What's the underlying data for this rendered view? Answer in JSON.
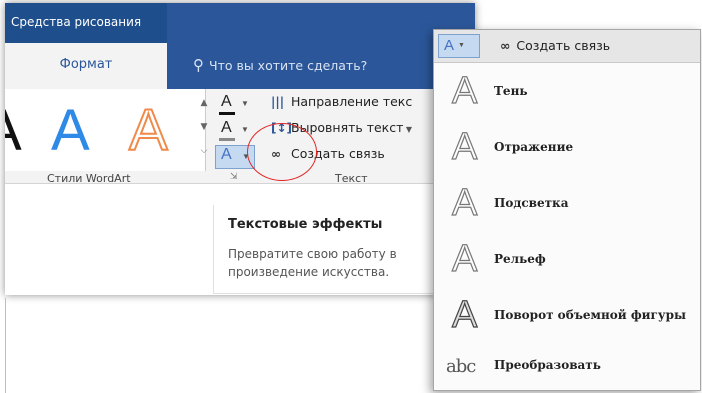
{
  "ribbon": {
    "context_tab": "Средства рисования",
    "format_tab": "Формат",
    "tell_me": "Что вы хотите сделать?",
    "group_wordart": "Стили WordArt",
    "group_text": "Текст",
    "btn_direction": "Направление текс",
    "btn_align": "Выровнять текст",
    "btn_link": "Создать связь"
  },
  "tooltip": {
    "title": "Текстовые эффекты",
    "desc": "Превратите свою работу в произведение искусства."
  },
  "dropdown": {
    "link": "Создать связь",
    "items": [
      "Тень",
      "Отражение",
      "Подсветка",
      "Рельеф",
      "Поворот объемной фигуры",
      "Преобразовать"
    ],
    "abc_icon": "abc"
  },
  "colors": {
    "accent": "#2b579a",
    "selected": "#c5d9f1",
    "highlight": "#e32727"
  },
  "icons": [
    "lightbulb-icon",
    "link-icon",
    "text-effects-icon",
    "text-fill-icon",
    "text-outline-icon",
    "text-direction-icon",
    "align-text-icon",
    "dialog-launcher-icon"
  ]
}
